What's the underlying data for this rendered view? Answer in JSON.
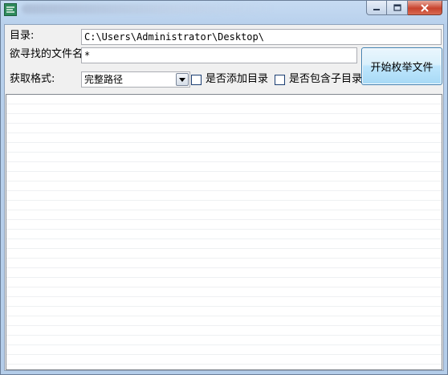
{
  "window": {
    "icon": "app-icon",
    "buttons": [
      "minimize-icon",
      "maximize-icon",
      "close-icon"
    ]
  },
  "form": {
    "dir_label": "目录:",
    "dir_value": "C:\\Users\\Administrator\\Desktop\\",
    "filename_label": "欲寻找的文件名:",
    "filename_value": "*",
    "format_label": "获取格式:",
    "format_selected": "完整路径",
    "add_dir_label": "是否添加目录",
    "include_sub_label": "是否包含子目录",
    "start_button": "开始枚举文件"
  },
  "results": []
}
